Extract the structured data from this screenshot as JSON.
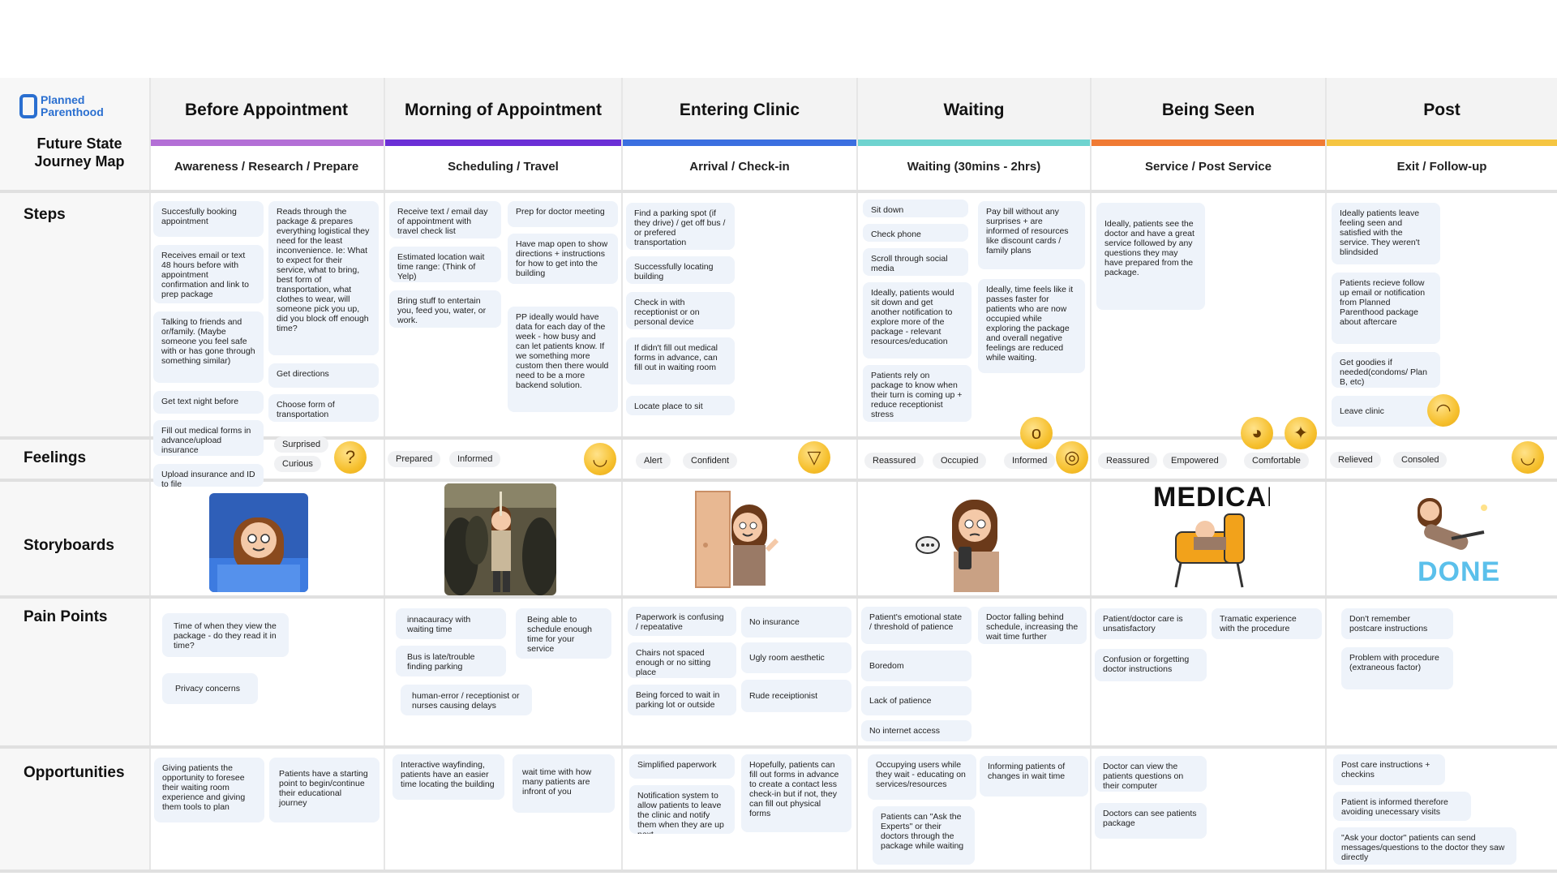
{
  "logo": {
    "line1": "Planned",
    "line2": "Parenthood"
  },
  "map_title": {
    "line1": "Future State",
    "line2": "Journey Map"
  },
  "stages": [
    {
      "title": "Before Appointment",
      "sub": "Awareness / Research / Prepare",
      "color": "#b36fd6"
    },
    {
      "title": "Morning of Appointment",
      "sub": "Scheduling / Travel",
      "color": "#6b2fd6"
    },
    {
      "title": "Entering Clinic",
      "sub": "Arrival / Check-in",
      "color": "#3b6fe0"
    },
    {
      "title": "Waiting",
      "sub": "Waiting (30mins - 2hrs)",
      "color": "#6ed3cf"
    },
    {
      "title": "Being Seen",
      "sub": "Service / Post Service",
      "color": "#f07a34"
    },
    {
      "title": "Post",
      "sub": "Exit / Follow-up",
      "color": "#f5c542"
    }
  ],
  "rows": {
    "steps": "Steps",
    "feelings": "Feelings",
    "storyboards": "Storyboards",
    "pain_points": "Pain Points",
    "opportunities": "Opportunities"
  },
  "steps": [
    "Succesfully booking appointment",
    "Receives email or text 48 hours before with appointment confirmation and link to prep package",
    "Talking to friends and or/family. (Maybe someone you feel safe with or has gone through something similar)",
    "Get text night before",
    "Fill out medical forms in advance/upload insurance",
    "Upload insurance and ID to file",
    "Reads through the package & prepares everything logistical they need for the least inconvenience. Ie: What to expect for their service, what to bring, best form of transportation, what clothes to wear, will someone pick you up, did you block off enough time?",
    "Get directions",
    "Choose form of transportation",
    "Receive text / email day of appointment with travel check list",
    "Estimated location wait time range: (Think of Yelp)",
    "Bring stuff to entertain you, feed you, water, or work.",
    "Prep for doctor meeting",
    "Have map open to show directions + instructions for how to get into the building",
    "PP ideally would have data for each day of the week - how busy and can let patients know. If we something more custom then there would need to be a more backend solution.",
    "Find a parking spot (if they drive) / get off bus / or prefered transportation",
    "Successfully locating building",
    "Check in with receptionist or on personal device",
    "If didn't fill out medical forms in advance, can fill out in waiting room",
    "Locate place to sit",
    "Sit down",
    "Check phone",
    "Scroll through social media",
    "Ideally, patients would sit down and get another notification to explore more of the package - relevant resources/education",
    "Patients rely on package to know when their turn is coming up + reduce receptionist stress",
    "Pay  bill without any surprises + are informed of resources like discount cards / family plans",
    "Ideally, time feels like it passes faster for patients who are now occupied while exploring the package and overall negative feelings are reduced while waiting.",
    "Ideally, patients see the doctor and have a great service followed by any questions they may have prepared from the package.",
    "Ideally patients leave feeling seen and satisfied with the service. They weren't blindsided",
    "Patients recieve follow up email or notification from Planned Parenthood package about aftercare",
    "Get goodies if needed(condoms/ Plan B, etc)",
    "Leave clinic"
  ],
  "feelings": [
    "Surprised",
    "Curious",
    "Prepared",
    "Informed",
    "Alert",
    "Confident",
    "Reassured",
    "Occupied",
    "Informed",
    "Reassured",
    "Empowered",
    "Comfortable",
    "Relieved",
    "Consoled"
  ],
  "emojis": [
    "thinking-face-icon",
    "relieved-face-icon",
    "grinning-face-icon",
    "yawning-face-icon",
    "monocle-face-icon",
    "pleading-face-icon",
    "partying-face-icon",
    "saluting-face-icon",
    "smiling-face-icon"
  ],
  "story_labels": {
    "medical": "MEDICAL",
    "done": "DONE"
  },
  "pain_points": [
    "Time of when they view the package - do they read it in time?",
    "Privacy concerns",
    "innacauracy with waiting time",
    "Bus is late/trouble finding parking",
    "human-error / receptionist or nurses causing delays",
    "Being able to schedule enough time for your service",
    "Paperwork is confusing / repeatative",
    "Chairs not spaced enough or no sitting place",
    "Being forced to wait in parking lot or outside",
    "No insurance",
    "Ugly room aesthetic",
    "Rude receiptionist",
    "Patient's emotional state / threshold of patience",
    "Boredom",
    "Lack of patience",
    "No internet access",
    "Doctor falling behind schedule, increasing the wait time further",
    "Patient/doctor care is unsatisfactory",
    "Confusion or forgetting doctor instructions",
    "Tramatic experience with the procedure",
    "Don't remember postcare instructions",
    "Problem with procedure (extraneous factor)"
  ],
  "opportunities": [
    "Giving patients the opportunity to foresee their waiting room experience and giving them tools to plan",
    "Patients have a starting point to begin/continue their educational journey",
    "Interactive wayfinding, patients have an easier time locating the building",
    "wait time with how many patients are infront of you",
    "Simplified paperwork",
    "Notification system to allow patients to leave the clinic and notify them when they are up next",
    "Hopefully, patients can fill out forms in advance to create a contact less check-in but if not, they can fill out physical forms",
    "Occupying users while they wait - educating on services/resources",
    "Patients can \"Ask the Experts\" or their doctors through the package while waiting",
    "Informing patients of changes in wait time",
    "Doctor can view the patients questions on their computer",
    "Doctors can see patients package",
    "Post care instructions + checkins",
    "Patient is informed therefore avoiding unecessary visits",
    "\"Ask your doctor\" patients can send messages/questions to the doctor they saw directly"
  ]
}
